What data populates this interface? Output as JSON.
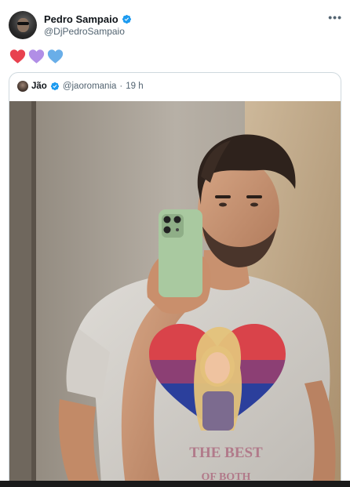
{
  "author": {
    "display_name": "Pedro Sampaio",
    "handle": "@DjPedroSampaio",
    "avatar_icon": "avatar-photo",
    "verified_icon": "verified-badge-icon"
  },
  "more_menu_icon": "more-options-icon",
  "tweet_text_emojis": [
    {
      "name": "red-heart-icon",
      "color": "#e8414f"
    },
    {
      "name": "purple-heart-icon",
      "color": "#b18ee6"
    },
    {
      "name": "blue-heart-icon",
      "color": "#69aee8"
    }
  ],
  "quoted_tweet": {
    "display_name": "Jão",
    "handle": "@jaoromania",
    "separator": "·",
    "time": "19 h",
    "image_shirt_text": "THE BEST OF BOTH"
  },
  "colors": {
    "verified_blue": "#1d9bf0",
    "border": "#cfd9de",
    "secondary_text": "#536471"
  }
}
